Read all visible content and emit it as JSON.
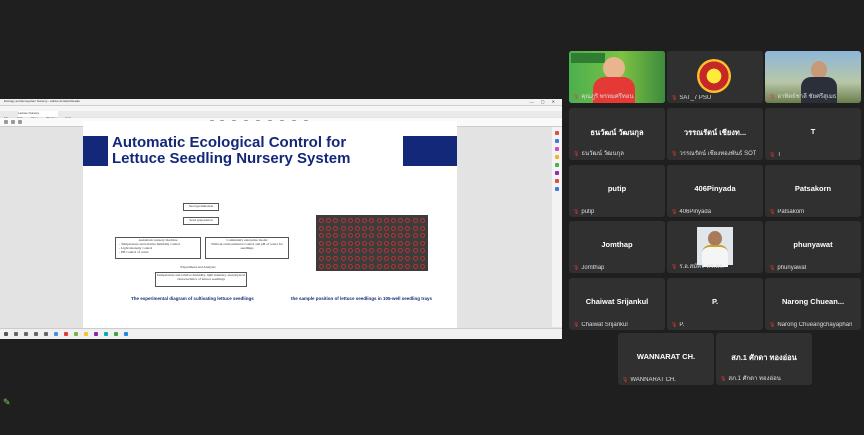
{
  "window": {
    "title": "Ecology and Ecosystem Nursery - Adobe Acrobat Reader",
    "menu": [
      "File",
      "Edit",
      "View",
      "Window",
      "Help"
    ],
    "tab": "Lettuce Nursery"
  },
  "slide": {
    "title_line1": "Automatic Ecological Control for",
    "title_line2": "Lettuce Seedling Nursery System",
    "caption_left": "The experimental diagram of cultivating lettuce seedlings",
    "caption_right": "the sample position of lettuce seedlings in 105-well seedling trays",
    "flow": {
      "seed_germination": "Seed germination",
      "seed_preparation": "Seed preparation",
      "auto_title": "Automatic nursery machine",
      "auto_lines": "- Temperature and relative humidity control\n- Light intensity control\n- EB control of water",
      "comm_title": "Community enterprise model",
      "comm_lines": "Without environmental control and pH of water for seedlings",
      "experiment": "Experiment and Analysis",
      "result": "Temperature and relative humidity, light intensity, and physical characteristics of lettuce seedlings"
    }
  },
  "participants": [
    {
      "label": "คุณภูริ พรหมศรีทอน",
      "display": "",
      "type": "video-presenter",
      "active": true
    },
    {
      "label": "SAT_7 PSU",
      "display": "",
      "type": "logo"
    },
    {
      "label": "อาทิตย์ชาลี ชัยศรีสุเมธ",
      "display": "",
      "type": "video"
    },
    {
      "label": "ธนวัฒน์ วัฒนกุล",
      "display": "ธนวัฒน์ วัฒนกุล"
    },
    {
      "label": "วรรณรัตน์ เชียงทองพันธ์ SOT",
      "display": "วรรณรัตน์ เชียงท..."
    },
    {
      "label": "T",
      "display": "T"
    },
    {
      "label": "putip",
      "display": "putip"
    },
    {
      "label": "406Pinyada",
      "display": "406Pinyada"
    },
    {
      "label": "Patsakorn",
      "display": "Patsakorn"
    },
    {
      "label": "Jomthap",
      "display": "Jomthap"
    },
    {
      "label": "ร.อ.สมัคร-ทร.พร.",
      "display": "",
      "type": "photo"
    },
    {
      "label": "phunyawat",
      "display": "phunyawat"
    },
    {
      "label": "Chaiwat Srijankul",
      "display": "Chaiwat Srijankul"
    },
    {
      "label": "P.",
      "display": "P."
    },
    {
      "label": "Narong Chueangchayaphan",
      "display": "Narong Chuean..."
    },
    {
      "label": "WANNARAT CH.",
      "display": "WANNARAT CH."
    },
    {
      "label": "สภ.1 ศักดา ทองอ่อน",
      "display": "สภ.1 ศักดา ทองอ่อน"
    }
  ],
  "colors": {
    "accent": "#b8d934",
    "slide_blue": "#14287a",
    "mic_off": "#e53935"
  }
}
